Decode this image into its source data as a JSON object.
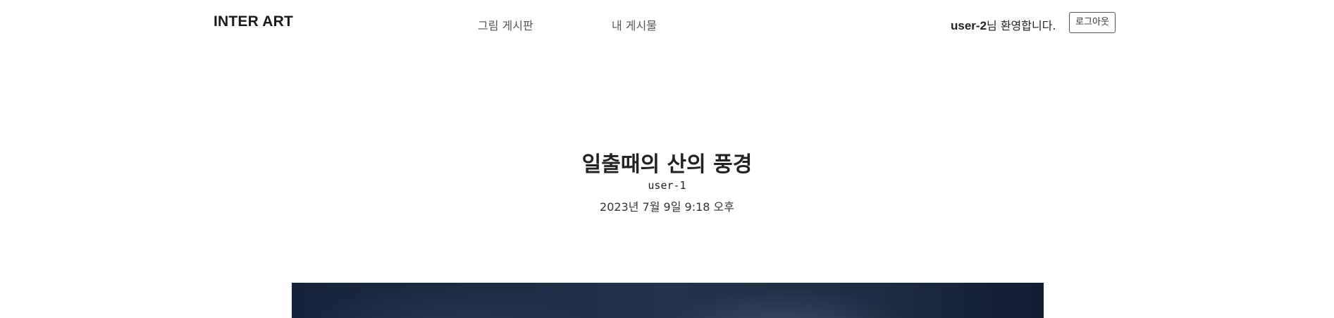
{
  "header": {
    "logo": "INTER ART",
    "nav": {
      "gallery": "그림 게시판",
      "my_posts": "내 게시물"
    },
    "welcome": {
      "username": "user-2",
      "suffix": "님 환영합니다."
    },
    "logout_label": "로그아웃"
  },
  "post": {
    "title": "일출때의 산의 풍경",
    "author": "user-1",
    "date": "2023년 7월 9일 9:18 오후"
  },
  "colors": {
    "background": "#ffffff",
    "text": "#222222",
    "nav_text": "#555555",
    "artwork_dark": "#15243a"
  }
}
